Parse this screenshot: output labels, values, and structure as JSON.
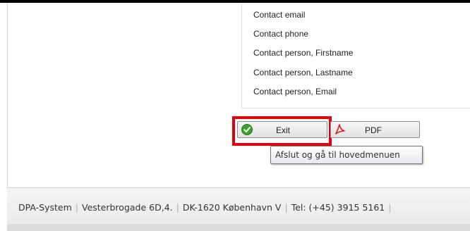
{
  "fields": {
    "items": [
      "Contact email",
      "Contact phone",
      "Contact person, Firstname",
      "Contact person, Lastname",
      "Contact person, Email"
    ]
  },
  "buttons": {
    "exit_label": "Exit",
    "pdf_label": "PDF",
    "exit_icon": "green-check-icon",
    "pdf_icon": "pdf-icon"
  },
  "tooltip": {
    "text": "Afslut og gå til hovedmenuen"
  },
  "footer": {
    "company": "DPA-System",
    "address": "Vesterbrogade 6D,4.",
    "city": "DK-1620 København V",
    "phone": "Tel: (+45) 3915 5161"
  },
  "colors": {
    "highlight": "#e0000e",
    "check_green": "#3f9f2f",
    "pdf_red": "#d6201a"
  }
}
